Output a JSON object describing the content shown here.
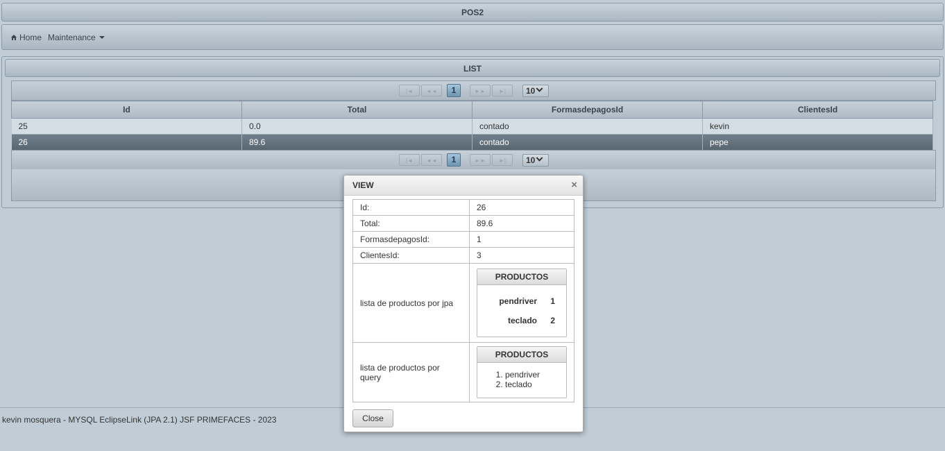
{
  "app": {
    "title": "POS2"
  },
  "menu": {
    "home": "Home",
    "maintenance": "Maintenance"
  },
  "list": {
    "header": "LIST",
    "paginator": {
      "current_page": "1",
      "rows_per_page": "10",
      "first": "|◄",
      "prev": "◄◄",
      "next": "►►",
      "last": "►|"
    },
    "columns": [
      "Id",
      "Total",
      "FormasdepagosId",
      "ClientesId"
    ],
    "rows": [
      {
        "id": "25",
        "total": "0.0",
        "formas": "contado",
        "clientes": "kevin",
        "selected": false
      },
      {
        "id": "26",
        "total": "89.6",
        "formas": "contado",
        "clientes": "pepe",
        "selected": true
      }
    ]
  },
  "footer": {
    "text": "kevin mosquera - MYSQL EclipseLink (JPA 2.1) JSF PRIMEFACES - 2023"
  },
  "dialog": {
    "title": "VIEW",
    "close_icon": "×",
    "fields": [
      {
        "label": "Id:",
        "value": "26"
      },
      {
        "label": "Total:",
        "value": "89.6"
      },
      {
        "label": "FormasdepagosId:",
        "value": "1"
      },
      {
        "label": "ClientesId:",
        "value": "3"
      }
    ],
    "jpa": {
      "label": "lista de productos por jpa",
      "panel_title": "PRODUCTOS",
      "items": [
        {
          "name": "pendriver",
          "qty": "1"
        },
        {
          "name": "teclado",
          "qty": "2"
        }
      ]
    },
    "query": {
      "label": "lista de productos por query",
      "panel_title": "PRODUCTOS",
      "items": [
        "pendriver",
        "teclado"
      ]
    },
    "close_label": "Close"
  }
}
